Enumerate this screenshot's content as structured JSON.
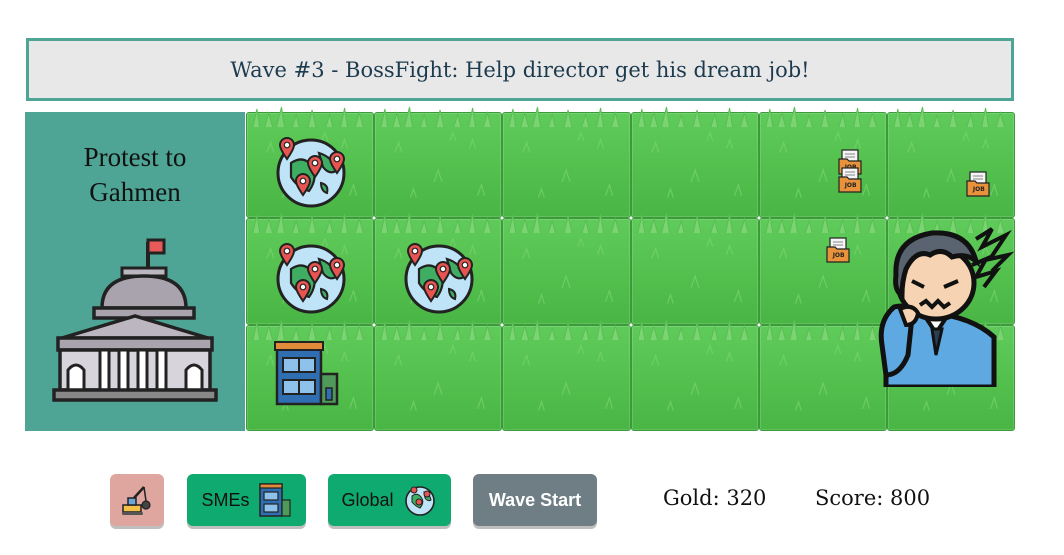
{
  "banner": {
    "text": "Wave #3 - BossFight: Help director get his dream job!"
  },
  "base": {
    "title_line1": "Protest to",
    "title_line2": "Gahmen",
    "icon": "government-building-icon"
  },
  "board": {
    "rows": 3,
    "cols": 6,
    "units": [
      {
        "row": 0,
        "col": 0,
        "type": "global-icon"
      },
      {
        "row": 1,
        "col": 0,
        "type": "global-icon"
      },
      {
        "row": 1,
        "col": 1,
        "type": "global-icon"
      },
      {
        "row": 2,
        "col": 0,
        "type": "sme-building-icon"
      }
    ],
    "job_labels": [
      "JOB",
      "JOB",
      "JOB",
      "JOB"
    ],
    "boss": "stressed-director-icon"
  },
  "toolbar": {
    "demolish_icon": "demolish-crane-icon",
    "smes_label": "SMEs",
    "global_label": "Global",
    "wave_label": "Wave Start"
  },
  "stats": {
    "gold": "Gold: 320",
    "score": "Score: 800"
  },
  "colors": {
    "accent": "#4fa595",
    "button_green": "#0faa70",
    "button_gray": "#6e7e84",
    "demolish_pink": "#dfa6a0",
    "grass": "#52be4c"
  }
}
